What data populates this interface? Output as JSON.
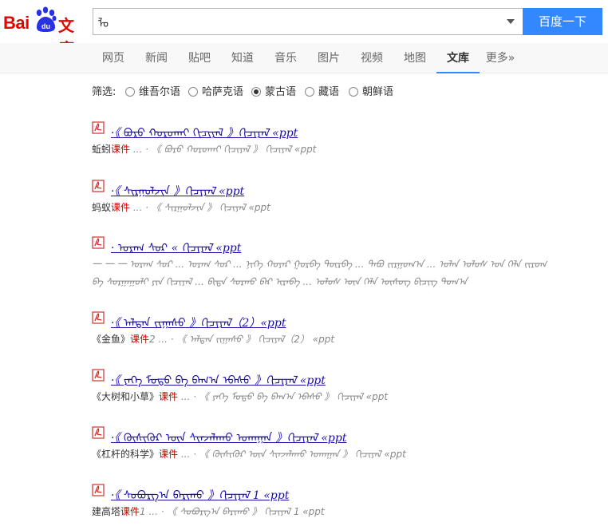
{
  "logo": {
    "bai": "Bai",
    "du": "du",
    "wenku": "文库"
  },
  "search": {
    "value": "ᠯᠣ",
    "button_label": "百度一下"
  },
  "nav": {
    "items": [
      {
        "label": "网页",
        "active": false
      },
      {
        "label": "新闻",
        "active": false
      },
      {
        "label": "贴吧",
        "active": false
      },
      {
        "label": "知道",
        "active": false
      },
      {
        "label": "音乐",
        "active": false
      },
      {
        "label": "图片",
        "active": false
      },
      {
        "label": "视频",
        "active": false
      },
      {
        "label": "地图",
        "active": false
      },
      {
        "label": "文库",
        "active": true
      },
      {
        "label": "更多»",
        "active": false
      }
    ]
  },
  "filter": {
    "label": "筛选:",
    "options": [
      {
        "label": "维吾尔语",
        "checked": false
      },
      {
        "label": "哈萨克语",
        "checked": false
      },
      {
        "label": "蒙古语",
        "checked": true
      },
      {
        "label": "藏语",
        "checked": false
      },
      {
        "label": "朝鲜语",
        "checked": false
      }
    ]
  },
  "results": [
    {
      "title_prefix": "·《",
      "title_mong": "ᠪᠣᠷᠣ ᠬᠣᠷᠣᠬᠠᠢ ᠬᠢᠴᠢᠶᠡᠯ",
      "title_suffix": "》ᠬᠢᠴᠢᠶᠡᠯ «ppt",
      "desc_prefix": "蚯蚓",
      "desc_kw": "课件",
      "desc_rest": "... · 《 ᠪᠣᠷᠣ ᠬᠣᠷᠣᠬᠠᠢ ᠬᠢᠴᠢᠶᠡᠯ 》 ᠬᠢᠴᠢᠶᠡᠯ «ppt",
      "desc2": ""
    },
    {
      "title_prefix": "·《",
      "title_mong": "ᠰᠢᠷᠭᠣᠯᠵᠢᠨ",
      "title_suffix": "》ᠬᠢᠴᠢᠶᠡᠯ «ppt",
      "desc_prefix": "蚂蚁",
      "desc_kw": "课件",
      "desc_rest": "... · 《 ᠰᠢᠷᠭᠣᠯᠵᠢᠨ 》 ᠬᠢᠴᠢᠶᠡᠯ «ppt",
      "desc2": ""
    },
    {
      "title_prefix": "·",
      "title_mong": "ᠤᠷᠠᠭ ᠰᠤᠷ",
      "title_suffix": "« ᠬᠢᠴᠢᠶᠡᠯ «ppt",
      "desc_prefix": "",
      "desc_kw": "",
      "desc_rest": "一 一 一 ᠤᠷᠠᠭ ᠰᠤᠷ ... ᠤᠷᠠᠭ ᠰᠤᠷ ... ᠨᠢᠭᠡ ᠬᠣᠶᠠᠷ ᠭᠤᠷᠪᠠ ᠳᠦᠷᠪᠡ ... ᠲᠠᠪᠤ ᠵᠢᠷᠭᠤᠭ᠎ᠠ ... ᠣᠯᠠᠨ ᠤᠯᠤᠰ ᠤᠨ ᠬᠡᠯᠡ ᠵᠢᠷᠤᠭ",
      "desc2": "ᠪᠠ ᠰᠤᠷᠭᠠᠭᠤᠯᠢ ᠶᠢᠨ ᠬᠢᠴᠢᠶᠡᠯ ... ᠪᠢᠳᠡ ᠰᠤᠷᠬᠤ ᠪᠠᠷ ᠢᠷᠡᠪᠡ ... ᠤᠯᠤᠰ ᠦᠨ ᠬᠡᠯᠡ ᠦᠰᠦᠭ ᠪᠢᠴᠢᠭ ᠲᠣᠭ᠎ᠠ"
    },
    {
      "title_prefix": "·《",
      "title_mong": "ᠠᠯᠲᠠᠨ ᠵᠢᠭᠠᠰᠤ",
      "title_suffix": "》ᠬᠢᠴᠢᠶᠡᠯ（2）«ppt",
      "desc_prefix": "《金鱼》",
      "desc_kw": "课件",
      "desc_rest": "2 ... · 《 ᠠᠯᠲᠠᠨ ᠵᠢᠭᠠᠰᠤ 》 ᠬᠢᠴᠢᠶᠡᠯ（2） «ppt",
      "desc2": ""
    },
    {
      "title_prefix": "·《",
      "title_mong": "ᠶᠡᠬᠡ ᠮᠣᠳᠣ ᠪᠠ ᠪᠠᠭ᠎ᠠ ᠡᠪᠡᠰᠦ",
      "title_suffix": "》ᠬᠢᠴᠢᠶᠡᠯ «ppt",
      "desc_prefix": "《大树和小草》",
      "desc_kw": "课件",
      "desc_rest": "... · 《 ᠶᠡᠬᠡ ᠮᠣᠳᠣ ᠪᠠ ᠪᠠᠭ᠎ᠠ ᠡᠪᠡᠰᠦ 》 ᠬᠢᠴᠢᠶᠡᠯ «ppt",
      "desc2": ""
    },
    {
      "title_prefix": "·《",
      "title_mong": "ᠬᠥᠰᠢᠭᠦᠷ ᠦᠨ ᠰᠢᠨᠵᠠᠯᠠᠬᠤ ᠤᠬᠠᠭᠠᠨ",
      "title_suffix": "》ᠬᠢᠴᠢᠶᠡᠯ «ppt",
      "desc_prefix": "《杠杆的科学》",
      "desc_kw": "课件",
      "desc_rest": "... · 《 ᠬᠥᠰᠢᠭᠦᠷ ᠦᠨ ᠰᠢᠨᠵᠠᠯᠠᠬᠤ ᠤᠬᠠᠭᠠᠨ 》 ᠬᠢᠴᠢᠶᠡᠯ «ppt",
      "desc2": ""
    },
    {
      "title_prefix": "·《",
      "title_mong": "ᠰᠤᠪᠤᠷᠭ᠎ᠠ ᠪᠠᠷᠢᠬᠤ",
      "title_suffix": "》ᠬᠢᠴᠢᠶᠡᠯ 1 «ppt",
      "desc_prefix": "建高塔",
      "desc_kw": "课件",
      "desc_rest": "1 ... · 《 ᠰᠤᠪᠤᠷᠭ᠎ᠠ ᠪᠠᠷᠢᠬᠤ 》 ᠬᠢᠴᠢᠶᠡᠯ 1 «ppt",
      "desc2": ""
    }
  ],
  "colors": {
    "accent": "#3388ff",
    "brand_red": "#e10602",
    "link": "#1a0dab",
    "keyword": "#cc0000"
  }
}
